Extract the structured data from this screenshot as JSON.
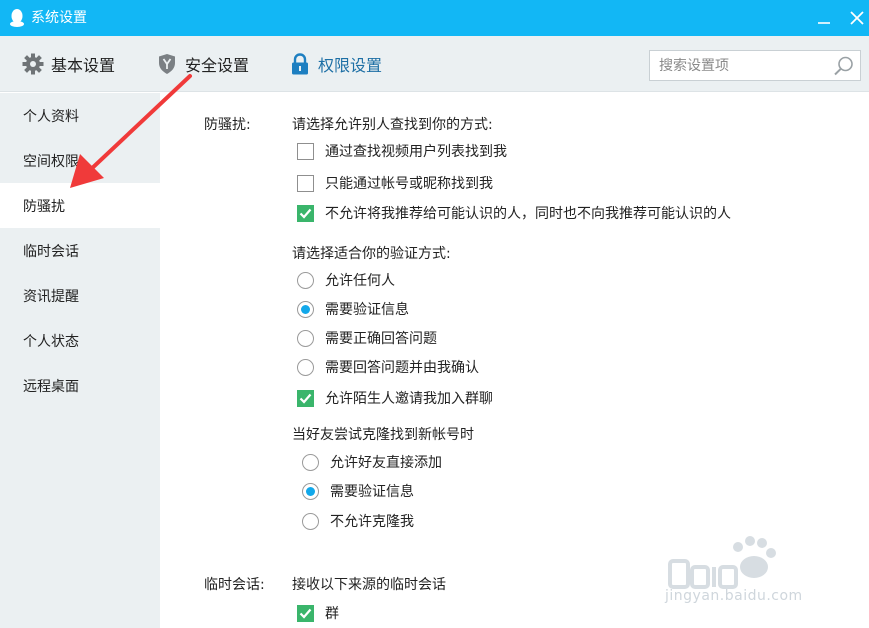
{
  "window": {
    "title": "系统设置",
    "accent_color": "#12b7f5"
  },
  "toolbar": {
    "tabs": [
      {
        "label": "基本设置",
        "icon": "gear-icon"
      },
      {
        "label": "安全设置",
        "icon": "shield-icon"
      },
      {
        "label": "权限设置",
        "icon": "lock-icon",
        "active": true
      }
    ],
    "search_placeholder": "搜索设置项"
  },
  "sidebar": {
    "items": [
      {
        "label": "个人资料"
      },
      {
        "label": "空间权限"
      },
      {
        "label": "防骚扰",
        "active": true
      },
      {
        "label": "临时会话"
      },
      {
        "label": "资讯提醒"
      },
      {
        "label": "个人状态"
      },
      {
        "label": "远程桌面"
      }
    ]
  },
  "anti_harass": {
    "label": "防骚扰:",
    "find_question": "请选择允许别人查找到你的方式:",
    "find_options": [
      {
        "label": "通过查找视频用户列表找到我",
        "checked": false
      },
      {
        "label": "只能通过帐号或昵称找到我",
        "checked": false
      },
      {
        "label": "不允许将我推荐给可能认识的人，同时也不向我推荐可能认识的人",
        "checked": true
      }
    ],
    "verify_question": "请选择适合你的验证方式:",
    "verify_options": [
      {
        "label": "允许任何人",
        "selected": false
      },
      {
        "label": "需要验证信息",
        "selected": true
      },
      {
        "label": "需要正确回答问题",
        "selected": false
      },
      {
        "label": "需要回答问题并由我确认",
        "selected": false
      }
    ],
    "invite_option": {
      "label": "允许陌生人邀请我加入群聊",
      "checked": true
    },
    "clone_question": "当好友尝试克隆找到新帐号时",
    "clone_options": [
      {
        "label": "允许好友直接添加",
        "selected": false
      },
      {
        "label": "需要验证信息",
        "selected": true
      },
      {
        "label": "不允许克隆我",
        "selected": false
      }
    ]
  },
  "temp_session": {
    "label": "临时会话:",
    "question": "接收以下来源的临时会话",
    "options": [
      {
        "label": "群",
        "checked": true
      }
    ]
  },
  "watermark": {
    "text": "jingyan.baidu.com"
  }
}
